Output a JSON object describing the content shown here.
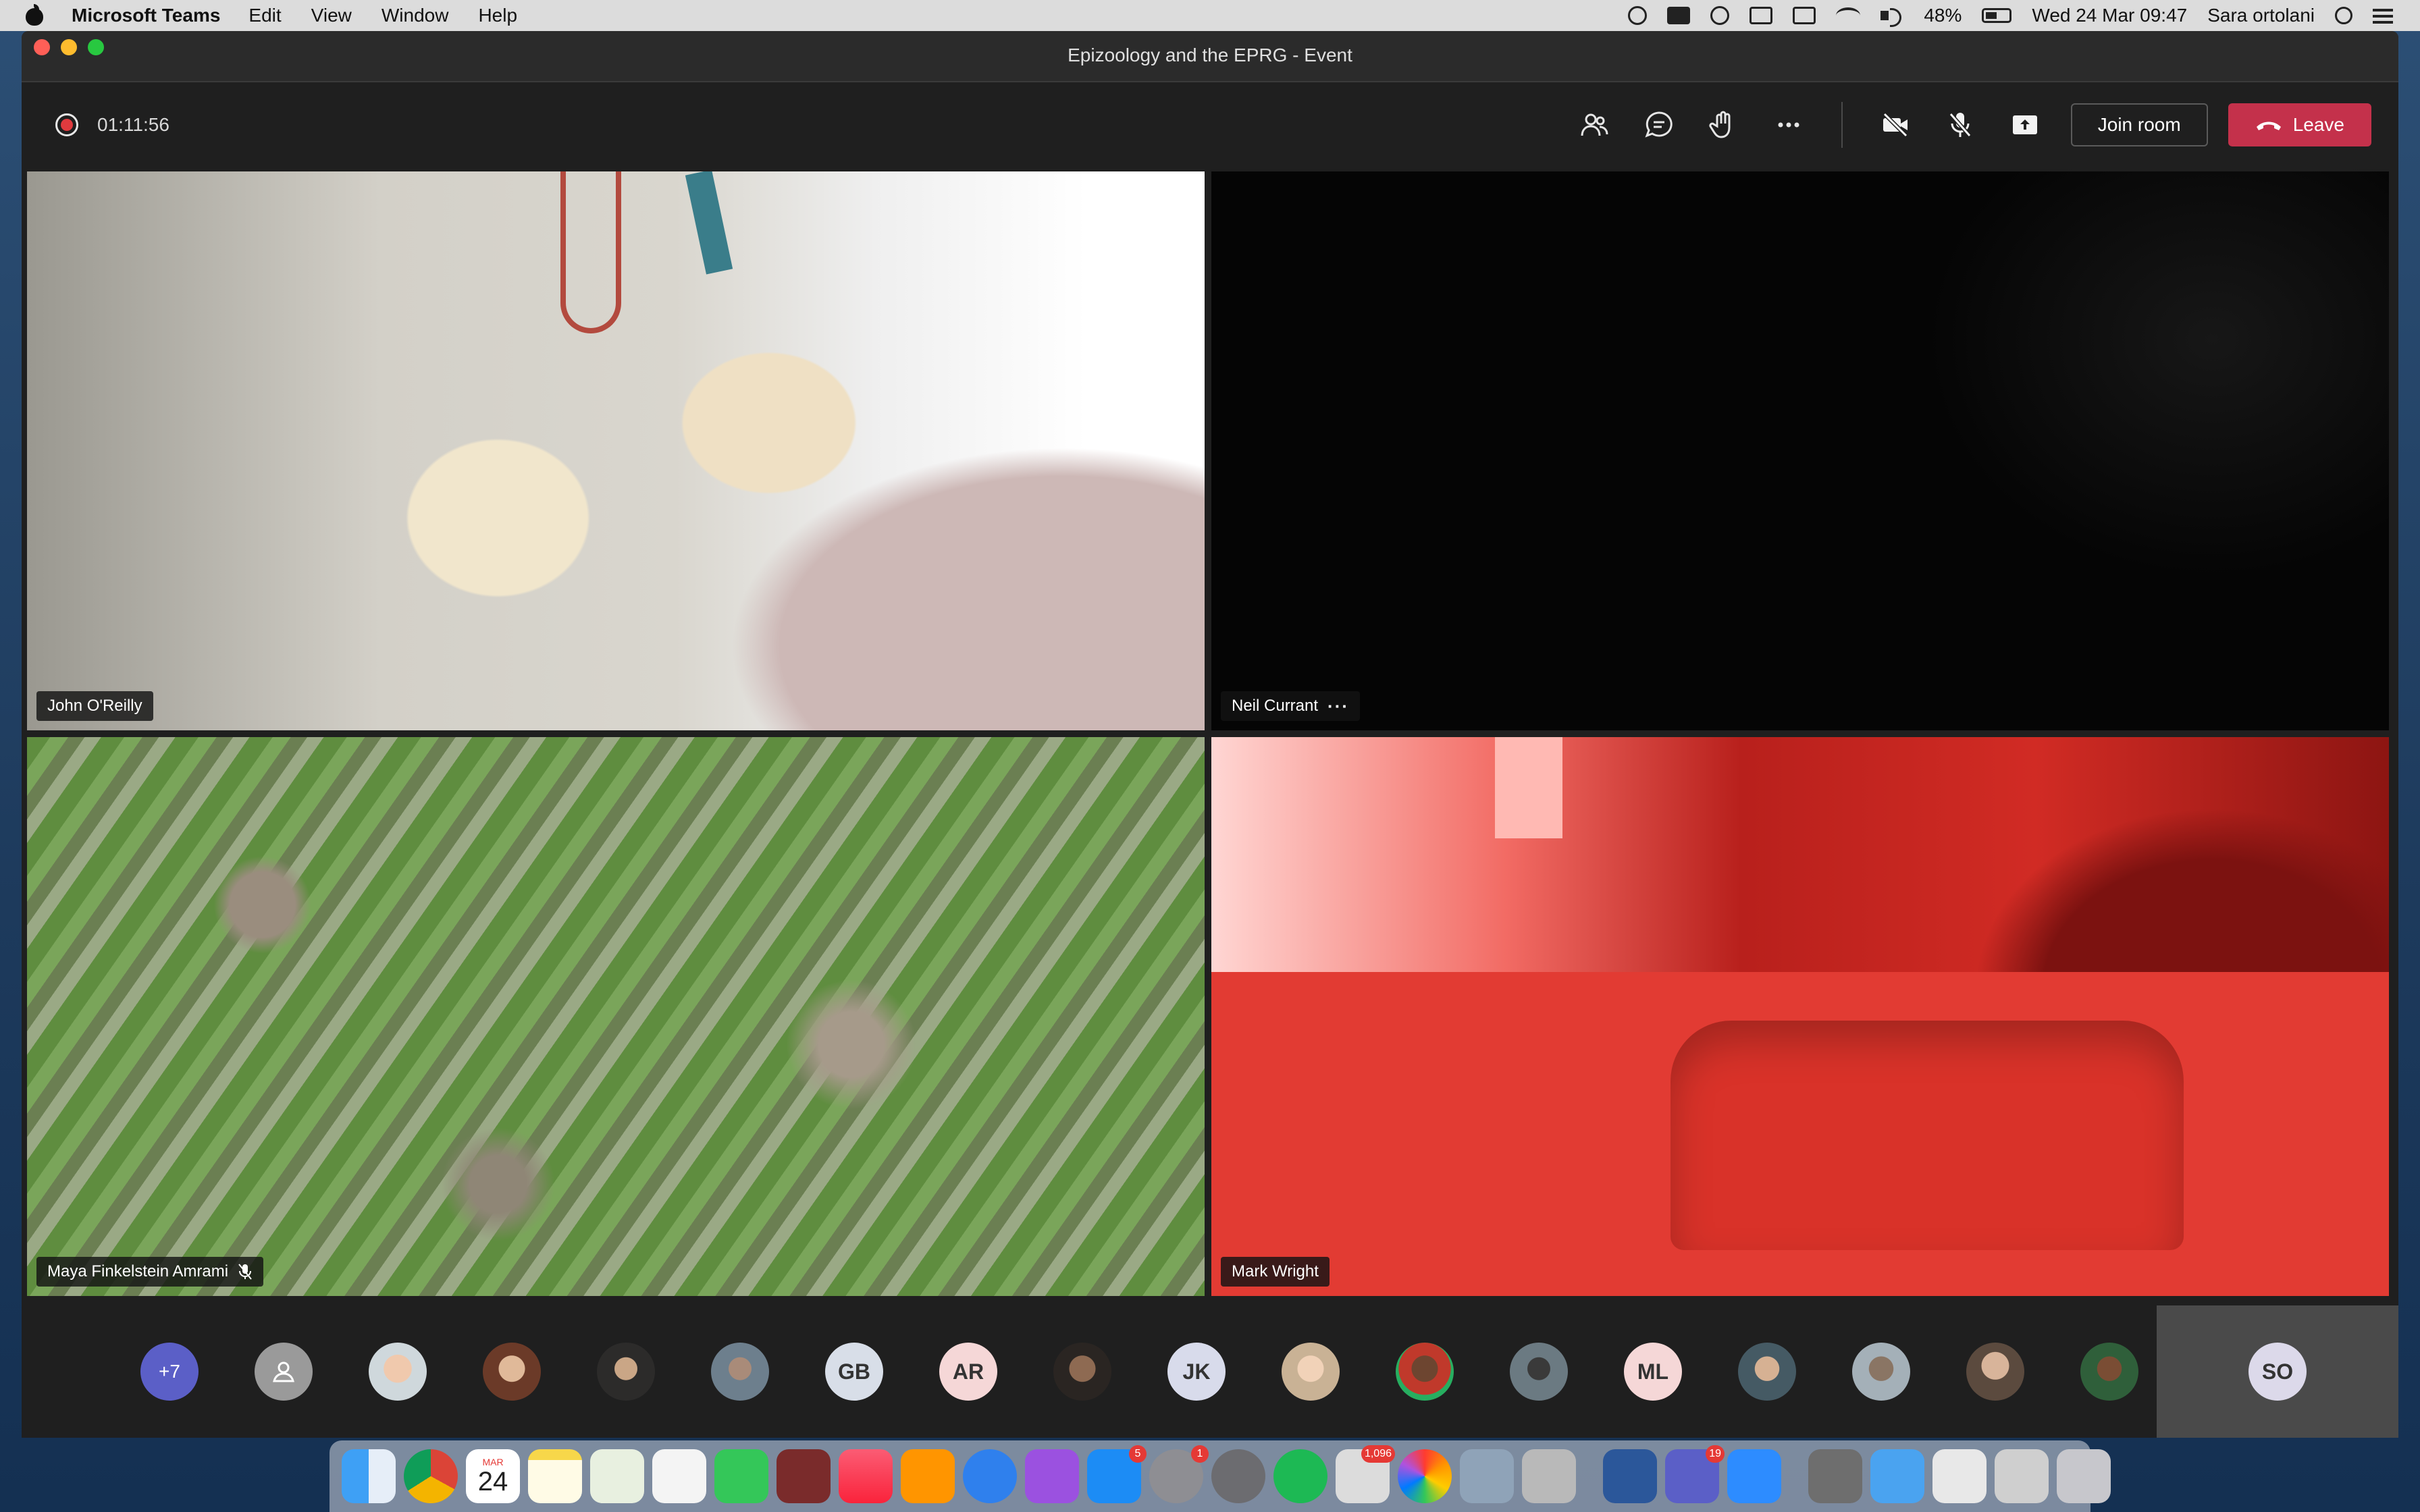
{
  "menubar": {
    "app_name": "Microsoft Teams",
    "menus": [
      "Edit",
      "View",
      "Window",
      "Help"
    ],
    "battery": "48%",
    "datetime": "Wed 24 Mar  09:47",
    "user": "Sara ortolani"
  },
  "window": {
    "title": "Epizoology and the EPRG - Event"
  },
  "toolbar": {
    "timer": "01:11:56",
    "join_label": "Join room",
    "leave_label": "Leave"
  },
  "tiles": [
    {
      "name": "John O'Reilly"
    },
    {
      "name": "Neil Currant",
      "more": "···"
    },
    {
      "name": "Maya Finkelstein Amrami"
    },
    {
      "name": "Mark Wright"
    }
  ],
  "participants": {
    "more_count": "+7",
    "initials": [
      "GB",
      "AR",
      "JK",
      "ML"
    ],
    "self": "SO"
  },
  "dock": {
    "calendar_month": "MAR",
    "calendar_day": "24",
    "badges": {
      "appstore": "5",
      "settings": "1",
      "mail": "1,096",
      "teams": "19"
    }
  },
  "colors": {
    "leave": "#c4314b",
    "more_avatar": "#5b5fc7",
    "record": "#e03a3e"
  }
}
